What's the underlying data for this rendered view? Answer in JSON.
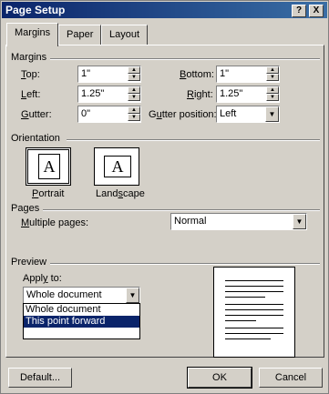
{
  "window": {
    "title": "Page Setup",
    "help_glyph": "?",
    "close_glyph": "X"
  },
  "tabs": [
    {
      "label": "Margins",
      "active": true
    },
    {
      "label": "Paper",
      "active": false
    },
    {
      "label": "Layout",
      "active": false
    }
  ],
  "margins": {
    "section": "Margins",
    "top": {
      "label_u": "T",
      "label_rest": "op:",
      "value": "1\""
    },
    "bottom": {
      "label_u": "B",
      "label_rest": "ottom:",
      "value": "1\""
    },
    "left": {
      "label_u": "L",
      "label_rest": "eft:",
      "value": "1.25\""
    },
    "right": {
      "label_u": "R",
      "label_rest": "ight:",
      "value": "1.25\""
    },
    "gutter": {
      "label_u": "G",
      "label_rest": "utter:",
      "value": "0\""
    },
    "gutter_position": {
      "label_pre": "G",
      "label_u": "u",
      "label_rest": "tter position:",
      "value": "Left"
    }
  },
  "orientation": {
    "section": "Orientation",
    "glyph": "A",
    "portrait": {
      "label_u": "P",
      "label_rest": "ortrait"
    },
    "landscape": {
      "label_pre": "Land",
      "label_u": "s",
      "label_rest": "cape"
    }
  },
  "pages": {
    "section": "Pages",
    "multiple_label_u": "M",
    "multiple_label_rest": "ultiple pages:",
    "multiple_value": "Normal"
  },
  "preview": {
    "section": "Preview",
    "apply_label_pre": "Appl",
    "apply_label_u": "y",
    "apply_label_rest": " to:",
    "apply_value": "Whole document",
    "options": [
      "Whole document",
      "This point forward"
    ]
  },
  "buttons": {
    "default": "Default...",
    "ok": "OK",
    "cancel": "Cancel"
  }
}
